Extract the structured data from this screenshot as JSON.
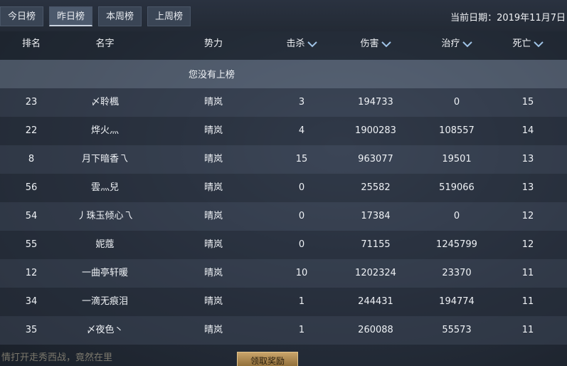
{
  "tabs": [
    {
      "label": "今日榜",
      "active": false
    },
    {
      "label": "昨日榜",
      "active": true
    },
    {
      "label": "本周榜",
      "active": false
    },
    {
      "label": "上周榜",
      "active": false
    }
  ],
  "date_label": "当前日期：2019年11月7日",
  "columns": {
    "rank": "排名",
    "name": "名字",
    "faction": "势力",
    "kills": "击杀",
    "damage": "伤害",
    "healing": "治疗",
    "deaths": "死亡"
  },
  "notice": "您没有上榜",
  "rows": [
    {
      "rank": "23",
      "name": "〆聆楓",
      "faction": "晴岚",
      "kills": "3",
      "damage": "194733",
      "healing": "0",
      "deaths": "15"
    },
    {
      "rank": "22",
      "name": "烨火灬",
      "faction": "晴岚",
      "kills": "4",
      "damage": "1900283",
      "healing": "108557",
      "deaths": "14"
    },
    {
      "rank": "8",
      "name": "月下暗香乁",
      "faction": "晴岚",
      "kills": "15",
      "damage": "963077",
      "healing": "19501",
      "deaths": "13"
    },
    {
      "rank": "56",
      "name": "雲灬兒",
      "faction": "晴岚",
      "kills": "0",
      "damage": "25582",
      "healing": "519066",
      "deaths": "13"
    },
    {
      "rank": "54",
      "name": "丿珠玉倾心乁",
      "faction": "晴岚",
      "kills": "0",
      "damage": "17384",
      "healing": "0",
      "deaths": "12"
    },
    {
      "rank": "55",
      "name": "妮蔻",
      "faction": "晴岚",
      "kills": "0",
      "damage": "71155",
      "healing": "1245799",
      "deaths": "12"
    },
    {
      "rank": "12",
      "name": "一曲亭轩暖",
      "faction": "晴岚",
      "kills": "10",
      "damage": "1202324",
      "healing": "23370",
      "deaths": "11"
    },
    {
      "rank": "34",
      "name": "一滴无痕泪",
      "faction": "晴岚",
      "kills": "1",
      "damage": "244431",
      "healing": "194774",
      "deaths": "11"
    },
    {
      "rank": "35",
      "name": "〆夜色丶",
      "faction": "晴岚",
      "kills": "1",
      "damage": "260088",
      "healing": "55573",
      "deaths": "11"
    }
  ],
  "reward_button": "领取奖励",
  "bottom_text": "情打开走秀西战，竟然在里"
}
